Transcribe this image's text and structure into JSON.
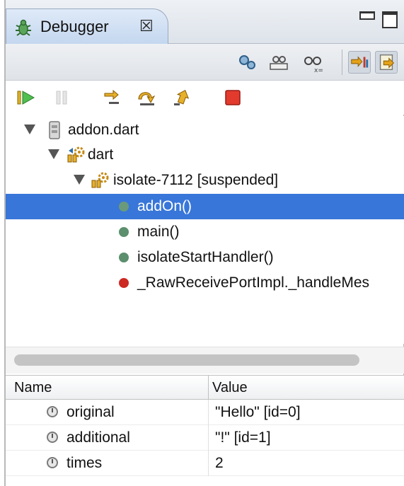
{
  "view": {
    "title": "Debugger",
    "close_glyph": "☒",
    "accent": "#3876d9"
  },
  "tree": {
    "project": "addon.dart",
    "launch": "dart",
    "isolate": "isolate-7112 [suspended]",
    "frames": [
      {
        "label": "addOn()",
        "status_color": "#6a9a7b",
        "selected": true
      },
      {
        "label": "main()",
        "status_color": "#5c8f6d",
        "selected": false
      },
      {
        "label": "isolateStartHandler()",
        "status_color": "#5c8f6d",
        "selected": false
      },
      {
        "label": "_RawReceivePortImpl._handleMes",
        "status_color": "#cc2a22",
        "selected": false
      }
    ]
  },
  "variables": {
    "columns": {
      "name": "Name",
      "value": "Value"
    },
    "rows": [
      {
        "name": "original",
        "value": "\"Hello\" [id=0]"
      },
      {
        "name": "additional",
        "value": "\"!\" [id=1]"
      },
      {
        "name": "times",
        "value": "2"
      }
    ]
  },
  "icons": {
    "tab": "bug-icon",
    "view_toolbar": [
      "breakpoints-icon",
      "show-variables-icon",
      "glasses-icon",
      "step-filter-icon",
      "expand-icon"
    ],
    "debug_toolbar": [
      "resume-icon",
      "suspend-icon",
      "step-into-icon",
      "step-over-icon",
      "step-return-icon",
      "terminate-icon"
    ]
  }
}
